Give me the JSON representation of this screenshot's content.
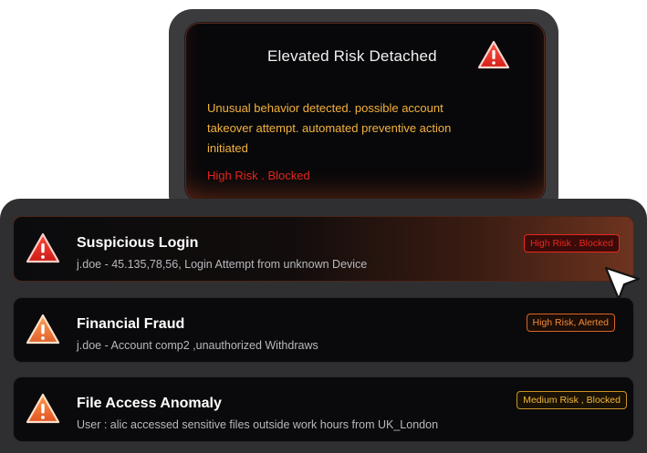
{
  "alert": {
    "title": "Elevated Risk Detached",
    "message_line1": "Unusual behavior detected. possible account",
    "message_line2": "takeover attempt. automated preventive action",
    "message_line3": "initiated",
    "status": "High Risk . Blocked",
    "icon": "warning-triangle-icon"
  },
  "events": [
    {
      "title": "Suspicious Login",
      "description": "j.doe - 45.135,78,56, Login Attempt from unknown Device",
      "badge": "High Risk . Blocked",
      "badge_color": "#e8281f",
      "icon": "warning-triangle-icon"
    },
    {
      "title": "Financial Fraud",
      "description": "j.doe - Account comp2 ,unauthorized Withdraws",
      "badge": "High Risk, Alerted",
      "badge_color": "#f08a3c",
      "icon": "warning-triangle-icon"
    },
    {
      "title": "File Access Anomaly",
      "description": "User : alic accessed sensitive files outside work hours from UK_London",
      "badge": "Medium Risk , Blocked",
      "badge_color": "#f2b83a",
      "icon": "warning-triangle-icon"
    }
  ],
  "colors": {
    "high_risk": "#e8281f",
    "alerted": "#f08a3c",
    "medium_risk": "#f2b83a",
    "alert_text": "#f3b23c"
  }
}
